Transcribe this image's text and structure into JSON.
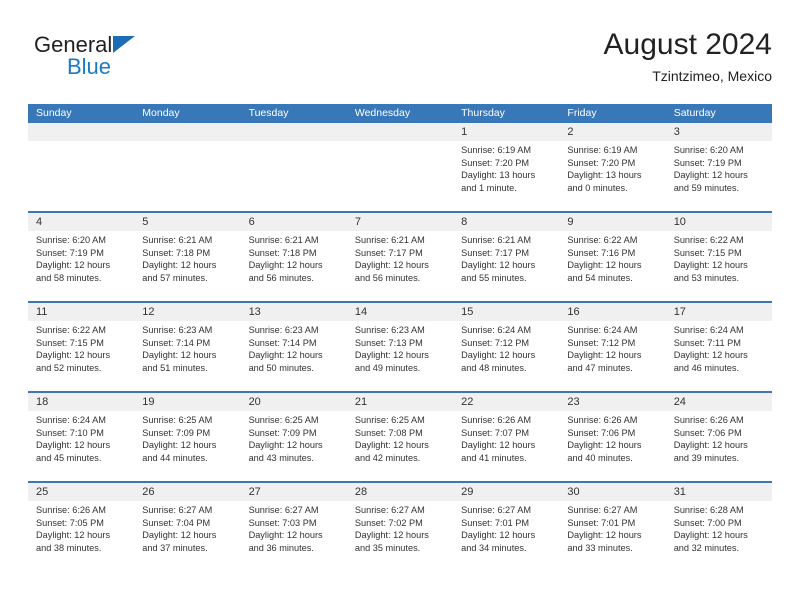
{
  "logo": {
    "word1": "General",
    "word2": "Blue",
    "triangle_color": "#1b6eb5",
    "blue_text_color": "#1b7ac4"
  },
  "header": {
    "title": "August 2024",
    "subtitle": "Tzintzimeo, Mexico"
  },
  "colors": {
    "header_blue": "#3878b8",
    "daynum_band": "#f0f0f0",
    "text": "#333333"
  },
  "weekdays": [
    "Sunday",
    "Monday",
    "Tuesday",
    "Wednesday",
    "Thursday",
    "Friday",
    "Saturday"
  ],
  "weeks": [
    [
      {
        "day": "",
        "lines": []
      },
      {
        "day": "",
        "lines": []
      },
      {
        "day": "",
        "lines": []
      },
      {
        "day": "",
        "lines": []
      },
      {
        "day": "1",
        "lines": [
          "Sunrise: 6:19 AM",
          "Sunset: 7:20 PM",
          "Daylight: 13 hours",
          "and 1 minute."
        ]
      },
      {
        "day": "2",
        "lines": [
          "Sunrise: 6:19 AM",
          "Sunset: 7:20 PM",
          "Daylight: 13 hours",
          "and 0 minutes."
        ]
      },
      {
        "day": "3",
        "lines": [
          "Sunrise: 6:20 AM",
          "Sunset: 7:19 PM",
          "Daylight: 12 hours",
          "and 59 minutes."
        ]
      }
    ],
    [
      {
        "day": "4",
        "lines": [
          "Sunrise: 6:20 AM",
          "Sunset: 7:19 PM",
          "Daylight: 12 hours",
          "and 58 minutes."
        ]
      },
      {
        "day": "5",
        "lines": [
          "Sunrise: 6:21 AM",
          "Sunset: 7:18 PM",
          "Daylight: 12 hours",
          "and 57 minutes."
        ]
      },
      {
        "day": "6",
        "lines": [
          "Sunrise: 6:21 AM",
          "Sunset: 7:18 PM",
          "Daylight: 12 hours",
          "and 56 minutes."
        ]
      },
      {
        "day": "7",
        "lines": [
          "Sunrise: 6:21 AM",
          "Sunset: 7:17 PM",
          "Daylight: 12 hours",
          "and 56 minutes."
        ]
      },
      {
        "day": "8",
        "lines": [
          "Sunrise: 6:21 AM",
          "Sunset: 7:17 PM",
          "Daylight: 12 hours",
          "and 55 minutes."
        ]
      },
      {
        "day": "9",
        "lines": [
          "Sunrise: 6:22 AM",
          "Sunset: 7:16 PM",
          "Daylight: 12 hours",
          "and 54 minutes."
        ]
      },
      {
        "day": "10",
        "lines": [
          "Sunrise: 6:22 AM",
          "Sunset: 7:15 PM",
          "Daylight: 12 hours",
          "and 53 minutes."
        ]
      }
    ],
    [
      {
        "day": "11",
        "lines": [
          "Sunrise: 6:22 AM",
          "Sunset: 7:15 PM",
          "Daylight: 12 hours",
          "and 52 minutes."
        ]
      },
      {
        "day": "12",
        "lines": [
          "Sunrise: 6:23 AM",
          "Sunset: 7:14 PM",
          "Daylight: 12 hours",
          "and 51 minutes."
        ]
      },
      {
        "day": "13",
        "lines": [
          "Sunrise: 6:23 AM",
          "Sunset: 7:14 PM",
          "Daylight: 12 hours",
          "and 50 minutes."
        ]
      },
      {
        "day": "14",
        "lines": [
          "Sunrise: 6:23 AM",
          "Sunset: 7:13 PM",
          "Daylight: 12 hours",
          "and 49 minutes."
        ]
      },
      {
        "day": "15",
        "lines": [
          "Sunrise: 6:24 AM",
          "Sunset: 7:12 PM",
          "Daylight: 12 hours",
          "and 48 minutes."
        ]
      },
      {
        "day": "16",
        "lines": [
          "Sunrise: 6:24 AM",
          "Sunset: 7:12 PM",
          "Daylight: 12 hours",
          "and 47 minutes."
        ]
      },
      {
        "day": "17",
        "lines": [
          "Sunrise: 6:24 AM",
          "Sunset: 7:11 PM",
          "Daylight: 12 hours",
          "and 46 minutes."
        ]
      }
    ],
    [
      {
        "day": "18",
        "lines": [
          "Sunrise: 6:24 AM",
          "Sunset: 7:10 PM",
          "Daylight: 12 hours",
          "and 45 minutes."
        ]
      },
      {
        "day": "19",
        "lines": [
          "Sunrise: 6:25 AM",
          "Sunset: 7:09 PM",
          "Daylight: 12 hours",
          "and 44 minutes."
        ]
      },
      {
        "day": "20",
        "lines": [
          "Sunrise: 6:25 AM",
          "Sunset: 7:09 PM",
          "Daylight: 12 hours",
          "and 43 minutes."
        ]
      },
      {
        "day": "21",
        "lines": [
          "Sunrise: 6:25 AM",
          "Sunset: 7:08 PM",
          "Daylight: 12 hours",
          "and 42 minutes."
        ]
      },
      {
        "day": "22",
        "lines": [
          "Sunrise: 6:26 AM",
          "Sunset: 7:07 PM",
          "Daylight: 12 hours",
          "and 41 minutes."
        ]
      },
      {
        "day": "23",
        "lines": [
          "Sunrise: 6:26 AM",
          "Sunset: 7:06 PM",
          "Daylight: 12 hours",
          "and 40 minutes."
        ]
      },
      {
        "day": "24",
        "lines": [
          "Sunrise: 6:26 AM",
          "Sunset: 7:06 PM",
          "Daylight: 12 hours",
          "and 39 minutes."
        ]
      }
    ],
    [
      {
        "day": "25",
        "lines": [
          "Sunrise: 6:26 AM",
          "Sunset: 7:05 PM",
          "Daylight: 12 hours",
          "and 38 minutes."
        ]
      },
      {
        "day": "26",
        "lines": [
          "Sunrise: 6:27 AM",
          "Sunset: 7:04 PM",
          "Daylight: 12 hours",
          "and 37 minutes."
        ]
      },
      {
        "day": "27",
        "lines": [
          "Sunrise: 6:27 AM",
          "Sunset: 7:03 PM",
          "Daylight: 12 hours",
          "and 36 minutes."
        ]
      },
      {
        "day": "28",
        "lines": [
          "Sunrise: 6:27 AM",
          "Sunset: 7:02 PM",
          "Daylight: 12 hours",
          "and 35 minutes."
        ]
      },
      {
        "day": "29",
        "lines": [
          "Sunrise: 6:27 AM",
          "Sunset: 7:01 PM",
          "Daylight: 12 hours",
          "and 34 minutes."
        ]
      },
      {
        "day": "30",
        "lines": [
          "Sunrise: 6:27 AM",
          "Sunset: 7:01 PM",
          "Daylight: 12 hours",
          "and 33 minutes."
        ]
      },
      {
        "day": "31",
        "lines": [
          "Sunrise: 6:28 AM",
          "Sunset: 7:00 PM",
          "Daylight: 12 hours",
          "and 32 minutes."
        ]
      }
    ]
  ]
}
